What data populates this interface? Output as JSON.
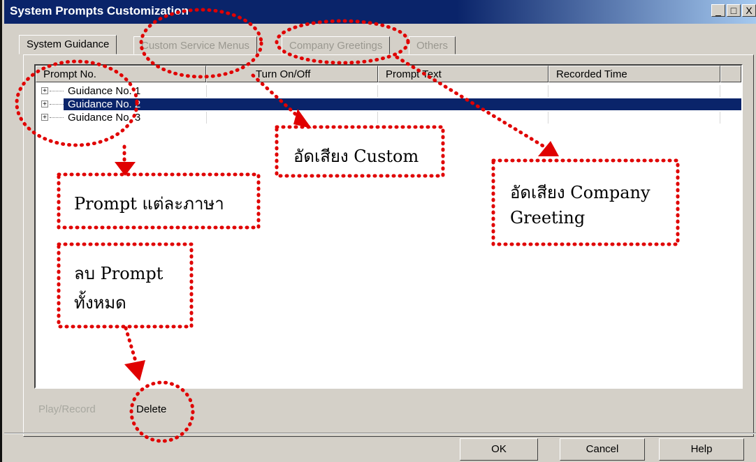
{
  "window": {
    "title": "System Prompts Customization",
    "controls": [
      "_",
      "□",
      "X"
    ]
  },
  "tabs": [
    {
      "label": "System Guidance",
      "active": true
    },
    {
      "label": "Custom Service Menus",
      "active": false
    },
    {
      "label": "Company Greetings",
      "active": false
    },
    {
      "label": "Others",
      "active": false
    }
  ],
  "columns": [
    "Prompt No.",
    "Turn On/Off",
    "Prompt Text",
    "Recorded Time"
  ],
  "rows": [
    {
      "label": "Guidance No. 1",
      "selected": false
    },
    {
      "label": "Guidance No. 2",
      "selected": true
    },
    {
      "label": "Guidance No. 3",
      "selected": false
    }
  ],
  "actions": {
    "play_record": "Play/Record",
    "delete": "Delete"
  },
  "buttons": {
    "ok": "OK",
    "cancel": "Cancel",
    "help": "Help"
  },
  "annotations": {
    "custom": "อัดเสียง Custom",
    "greeting_line1": "อัดเสียง Company",
    "greeting_line2": "Greeting",
    "prompt_lang": "Prompt แต่ละภาษา",
    "delete_line1": "ลบ Prompt",
    "delete_line2": "ทั้งหมด"
  },
  "colors": {
    "annotation": "#e00000",
    "selection": "#0a246a",
    "titlebar": "#0a246a"
  }
}
